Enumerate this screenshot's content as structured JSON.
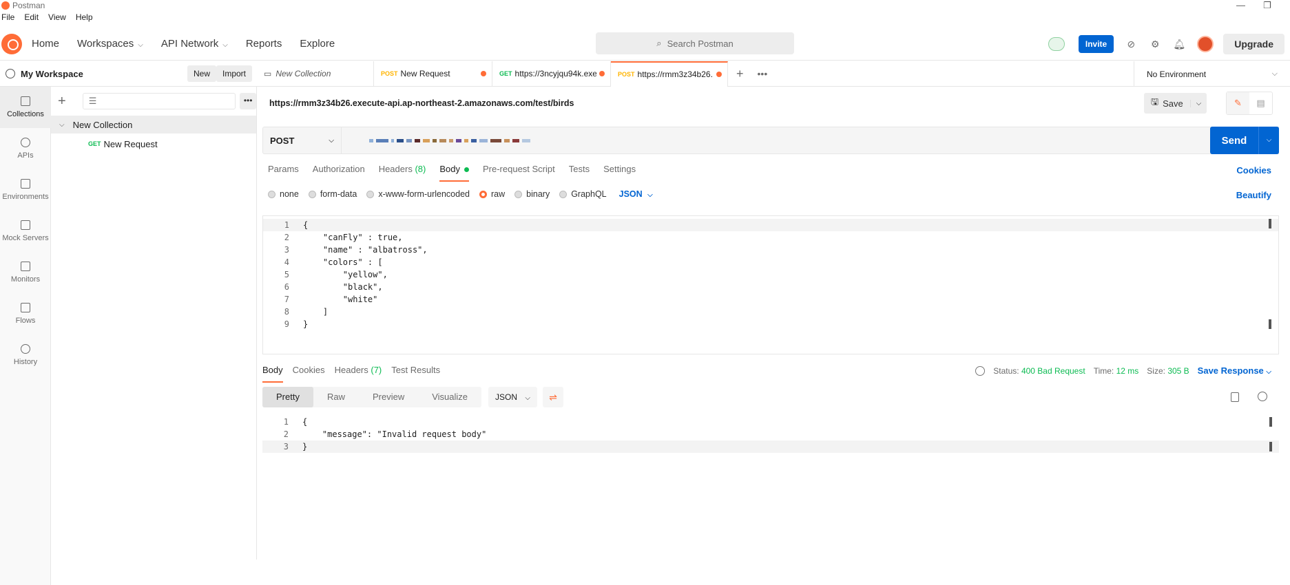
{
  "titlebar": {
    "title": "Postman",
    "min": "—",
    "restore": "❐"
  },
  "menu": [
    "File",
    "Edit",
    "View",
    "Help"
  ],
  "header": {
    "nav": [
      {
        "label": "Home",
        "chevron": false
      },
      {
        "label": "Workspaces",
        "chevron": true
      },
      {
        "label": "API Network",
        "chevron": true
      },
      {
        "label": "Reports",
        "chevron": false
      },
      {
        "label": "Explore",
        "chevron": false
      }
    ],
    "search_placeholder": "Search Postman",
    "invite_label": "Invite",
    "upgrade_label": "Upgrade"
  },
  "workspace": {
    "title": "My Workspace",
    "new_label": "New",
    "import_label": "Import"
  },
  "rail": [
    {
      "label": "Collections",
      "icon": "collections-icon",
      "active": true
    },
    {
      "label": "APIs",
      "icon": "apis-icon",
      "active": false
    },
    {
      "label": "Environments",
      "icon": "environments-icon",
      "active": false
    },
    {
      "label": "Mock Servers",
      "icon": "mock-servers-icon",
      "active": false
    },
    {
      "label": "Monitors",
      "icon": "monitors-icon",
      "active": false
    },
    {
      "label": "Flows",
      "icon": "flows-icon",
      "active": false
    },
    {
      "label": "History",
      "icon": "history-icon",
      "active": false
    }
  ],
  "sidebar": {
    "collection": "New Collection",
    "request": {
      "method": "GET",
      "name": "New Request"
    }
  },
  "tabs": [
    {
      "method": "",
      "label": "New Collection",
      "italic": true,
      "dot": false,
      "active": false
    },
    {
      "method": "POST",
      "label": "New Request",
      "italic": false,
      "dot": true,
      "active": false
    },
    {
      "method": "GET",
      "label": "https://3ncyjqu94k.exe",
      "italic": false,
      "dot": true,
      "active": false
    },
    {
      "method": "POST",
      "label": "https://rmm3z34b26.",
      "italic": false,
      "dot": true,
      "active": true
    }
  ],
  "environment": "No Environment",
  "request": {
    "title": "https://rmm3z34b26.execute-api.ap-northeast-2.amazonaws.com/test/birds",
    "method": "POST",
    "save_label": "Save",
    "send_label": "Send",
    "tabs": [
      {
        "label": "Params",
        "extra": ""
      },
      {
        "label": "Authorization",
        "extra": ""
      },
      {
        "label": "Headers",
        "extra": "(8)"
      },
      {
        "label": "Body",
        "extra": "dot",
        "active": true
      },
      {
        "label": "Pre-request Script",
        "extra": ""
      },
      {
        "label": "Tests",
        "extra": ""
      },
      {
        "label": "Settings",
        "extra": ""
      }
    ],
    "cookies_label": "Cookies",
    "body_types": [
      "none",
      "form-data",
      "x-www-form-urlencoded",
      "raw",
      "binary",
      "GraphQL"
    ],
    "body_type_selected": "raw",
    "language": "JSON",
    "beautify_label": "Beautify",
    "body_lines": [
      "{",
      "    \"canFly\" : true,",
      "    \"name\" : \"albatross\",",
      "    \"colors\" : [",
      "        \"yellow\",",
      "        \"black\",",
      "        \"white\"",
      "    ]",
      "}"
    ]
  },
  "response": {
    "tabs": [
      {
        "label": "Body",
        "extra": "",
        "active": true
      },
      {
        "label": "Cookies",
        "extra": ""
      },
      {
        "label": "Headers",
        "extra": "(7)"
      },
      {
        "label": "Test Results",
        "extra": ""
      }
    ],
    "status_label": "Status:",
    "status_value": "400 Bad Request",
    "time_label": "Time:",
    "time_value": "12 ms",
    "size_label": "Size:",
    "size_value": "305 B",
    "save_response_label": "Save Response",
    "view_modes": [
      "Pretty",
      "Raw",
      "Preview",
      "Visualize"
    ],
    "view_mode_selected": "Pretty",
    "format": "JSON",
    "body_lines": [
      "{",
      "    \"message\": \"Invalid request body\"",
      "}"
    ]
  },
  "colors": {
    "accent": "#ff6c37",
    "primary": "#0265d2",
    "success": "#0cbb52"
  }
}
